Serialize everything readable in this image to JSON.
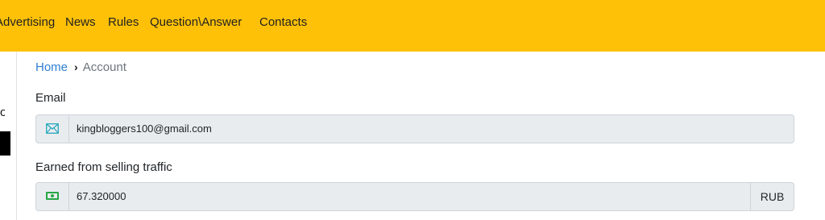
{
  "nav": {
    "items": [
      {
        "label": "Advertising"
      },
      {
        "label": "News"
      },
      {
        "label": "Rules"
      },
      {
        "label": "Question\\Answer"
      },
      {
        "label": "Contacts"
      }
    ]
  },
  "sidebar": {
    "glyph": "o"
  },
  "breadcrumb": {
    "home": "Home",
    "separator": "›",
    "current": "Account"
  },
  "email": {
    "label": "Email",
    "icon": "envelope-icon",
    "value": "kingbloggers100@gmail.com"
  },
  "earned": {
    "label": "Earned from selling traffic",
    "icon": "money-icon",
    "value": "67.320000",
    "currency": "RUB"
  },
  "colors": {
    "nav_bg": "#ffc107",
    "link": "#2f7fd3",
    "input_bg": "#e9ecef",
    "envelope_icon": "#17a2b8",
    "money_icon": "#28a745"
  }
}
